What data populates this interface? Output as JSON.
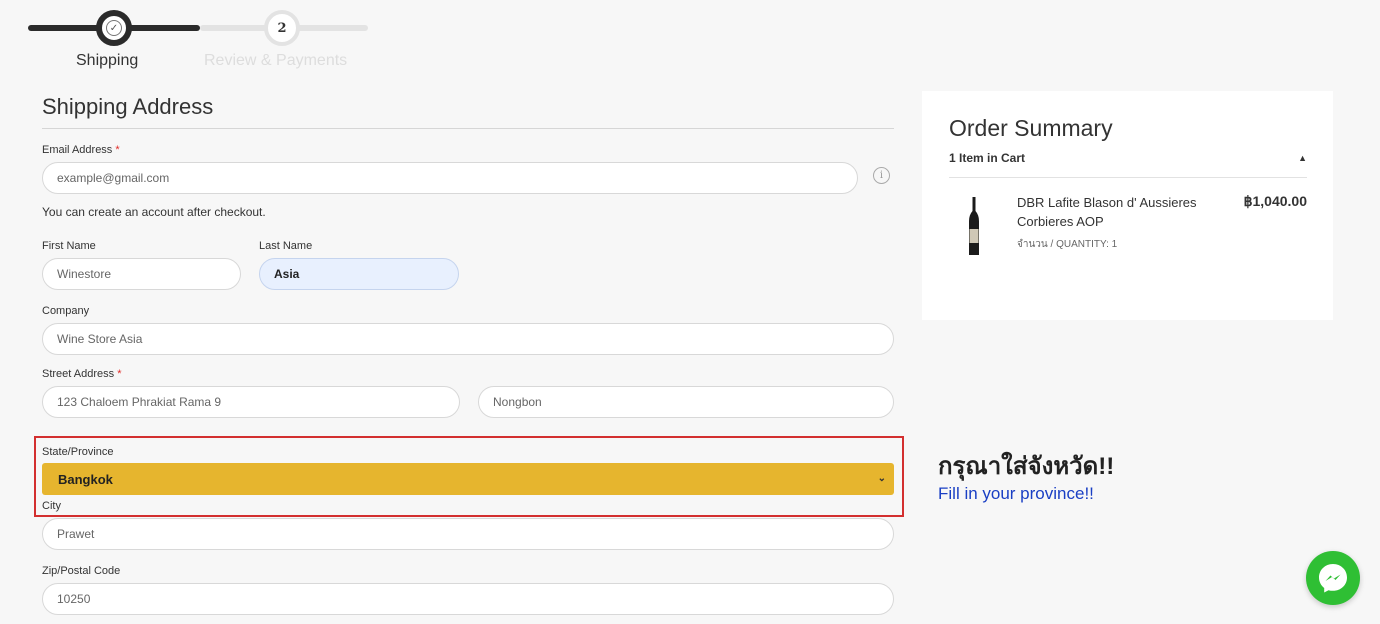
{
  "progress": {
    "step1_label": "Shipping",
    "step2_number": "2",
    "step2_label": "Review & Payments"
  },
  "form": {
    "title": "Shipping Address",
    "email": {
      "label": "Email Address",
      "required": "*",
      "placeholder": "example@gmail.com",
      "note": "You can create an account after checkout."
    },
    "first_name": {
      "label": "First Name",
      "value": "Winestore"
    },
    "last_name": {
      "label": "Last Name",
      "value": "Asia"
    },
    "company": {
      "label": "Company",
      "value": "Wine Store Asia"
    },
    "street": {
      "label": "Street Address",
      "required": "*",
      "line1": "123 Chaloem Phrakiat Rama 9",
      "line2": "Nongbon"
    },
    "state": {
      "label": "State/Province",
      "value": "Bangkok"
    },
    "city": {
      "label": "City",
      "value": "Prawet"
    },
    "zip": {
      "label": "Zip/Postal Code",
      "value": "10250"
    }
  },
  "summary": {
    "title": "Order Summary",
    "cart_count": "1 Item in Cart",
    "product_name": "DBR Lafite Blason d' Aussieres Corbieres AOP",
    "quantity": "จำนวน / QUANTITY: 1",
    "price": "฿1,040.00"
  },
  "annotation": {
    "thai": "กรุณาใส่จังหวัด!!",
    "english": "Fill in your province!!"
  },
  "colors": {
    "select_bg": "#e6b52e",
    "highlight_border": "#d32f2f",
    "messenger": "#2fbf34",
    "note_blue": "#1a3fc4"
  },
  "icons": [
    "check-icon",
    "info-icon",
    "chevron-down-icon",
    "caret-up-icon",
    "wine-bottle-icon",
    "messenger-icon"
  ]
}
